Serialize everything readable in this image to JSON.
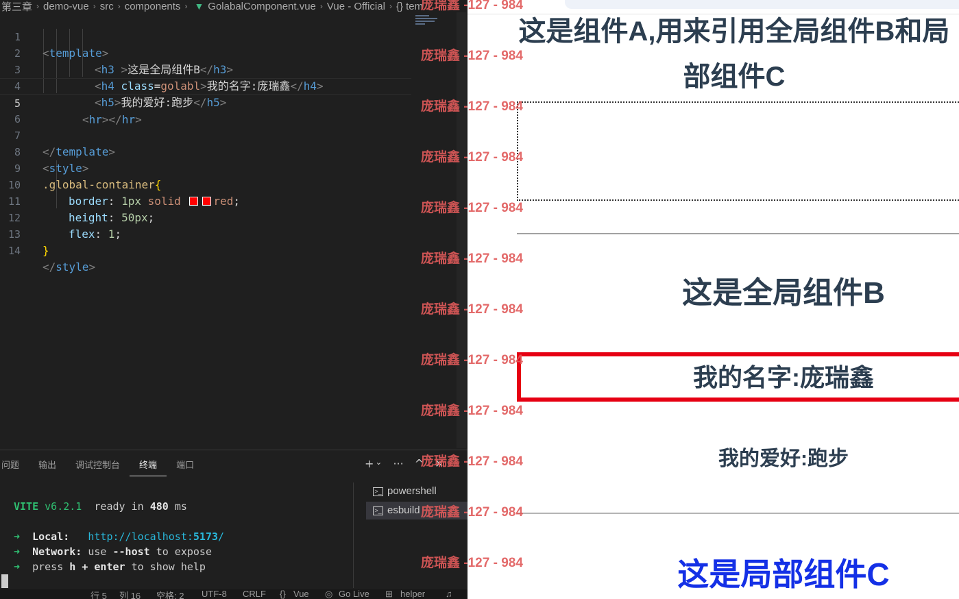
{
  "breadcrumb": {
    "items": [
      "第三章",
      "demo-vue",
      "src",
      "components",
      "GolabalComponent.vue",
      "Vue - Official",
      "{} tem"
    ]
  },
  "editor": {
    "active_line": "5",
    "lines": [
      {
        "no": "1"
      },
      {
        "no": "2"
      },
      {
        "no": "3"
      },
      {
        "no": "4"
      },
      {
        "no": "5"
      },
      {
        "no": "6"
      },
      {
        "no": "7"
      },
      {
        "no": "8"
      },
      {
        "no": "9"
      },
      {
        "no": "10"
      },
      {
        "no": "11"
      },
      {
        "no": "12"
      },
      {
        "no": "13"
      },
      {
        "no": "14"
      }
    ],
    "code": {
      "l1_tag": "template",
      "l2_tag": "h3",
      "l2_text": "这是全局组件B",
      "l3_tag": "h4",
      "l3_attr": "class",
      "l3_val": "golabl",
      "l3_text": "我的名字:庞瑞鑫",
      "l4_tag": "h5",
      "l4_text": "我的爱好:跑步",
      "l5_tag": "hr",
      "l7_tag": "template",
      "l8_tag": "style",
      "l9_selector": ".global-container",
      "l10_prop": "border",
      "l10_num": "1px",
      "l10_kw": "solid",
      "l10_val": "red",
      "l11_prop": "height",
      "l11_num": "50px",
      "l12_prop": "flex",
      "l12_num": "1",
      "l14_tag": "style"
    },
    "swatch_color": "#ff0000"
  },
  "panel": {
    "tabs": [
      "问题",
      "输出",
      "调试控制台",
      "终端",
      "端口"
    ],
    "active_tab": "终端",
    "actions": {
      "add": "+",
      "dropdown": "⌄",
      "more": "···",
      "maximize": "^",
      "close": "✕"
    },
    "terminal": {
      "vite_name": "VITE",
      "vite_version": "v6.2.1",
      "ready_pre": "ready in",
      "ready_ms": "480",
      "ready_unit": "ms",
      "local_label": "Local:",
      "local_url_base": "http://localhost:",
      "local_port": "5173",
      "local_slash": "/",
      "network_label": "Network:",
      "network_pre": "use",
      "network_flag": "--host",
      "network_post": "to expose",
      "help_pre": "press",
      "help_key": "h + enter",
      "help_post": "to show help",
      "arrow": "➜"
    },
    "terminals": [
      {
        "name": "powershell"
      },
      {
        "name": "esbuild"
      }
    ]
  },
  "statusbar": {
    "line": "行 5",
    "col": "列 16",
    "spaces": "空格: 2",
    "encoding": "UTF-8",
    "eol": "CRLF",
    "language": "Vue",
    "golive": "Go Live",
    "helper": "helper"
  },
  "browser": {
    "comp_a_title_line1": "这是组件A,用来引用全局组件B和局",
    "comp_a_title_line2": "部组件C",
    "b_title": "这是全局组件B",
    "b_name": "我的名字:庞瑞鑫",
    "b_hobby": "我的爱好:跑步",
    "c_title": "这是局部组件C"
  },
  "watermark": {
    "text": "庞瑞鑫 -127 - 984"
  }
}
